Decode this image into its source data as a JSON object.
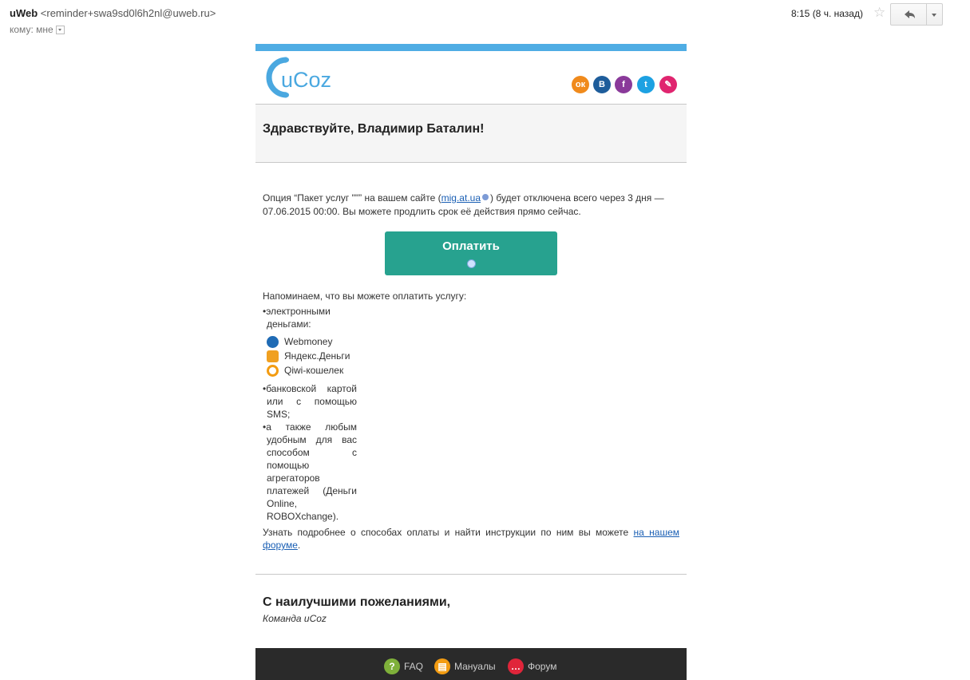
{
  "header": {
    "sender_name": "uWeb",
    "sender_email": "<reminder+swa9sd0l6h2nl@uweb.ru>",
    "to_line": "кому: мне",
    "time": "8:15 (8 ч. назад)",
    "star": "☆",
    "reply_icon": "↩"
  },
  "email": {
    "logo_text": "uCoz",
    "social": [
      {
        "icon": "odnoklassniki-icon",
        "glyph": "ок",
        "color": "#f08a1c"
      },
      {
        "icon": "vk-icon",
        "glyph": "B",
        "color": "#1e5d9b"
      },
      {
        "icon": "facebook-icon",
        "glyph": "f",
        "color": "#8a3a9a"
      },
      {
        "icon": "twitter-icon",
        "glyph": "t",
        "color": "#1da1e2"
      },
      {
        "icon": "edit-icon",
        "glyph": "✎",
        "color": "#e0256f"
      }
    ],
    "greeting": "Здравствуйте, Владимир Баталин!",
    "p1_before": "Опция “Пакет услуг \"\"” на вашем сайте (",
    "p1_link": "mig.at.ua",
    "p1_after": ") будет отключена всего через 3 дня — 07.06.2015 00:00. Вы можете продлить срок её действия прямо сейчас.",
    "pay_button": "Оплатить",
    "reminder": "Напоминаем, что вы можете оплатить услугу:",
    "item_emoney": "•электронными деньгами:",
    "methods": [
      {
        "label": "Webmoney",
        "icon": "webmoney-icon",
        "color": "#1f6bb5"
      },
      {
        "label": "Яндекс.Деньги",
        "icon": "yandex-money-icon",
        "color": "#f0a020"
      },
      {
        "label": "Qiwi-кошелек",
        "icon": "qiwi-icon",
        "color": "#f39c12"
      }
    ],
    "item_card": "•банковской картой или с помощью SMS;",
    "item_other": "•а также любым удобным для вас способом с помощью агрегаторов платежей (Деньги Online, ROBOXchange).",
    "more_before": "Узнать подробнее о способах оплаты и найти инструкции по ним вы можете ",
    "more_link": "на нашем форуме",
    "more_after": ".",
    "sign_title": "С наилучшими пожеланиями,",
    "sign_team": "Команда uCoz",
    "footer": [
      {
        "label": "FAQ",
        "icon": "faq-icon",
        "glyph": "?",
        "color": "#7fb03a"
      },
      {
        "label": "Мануалы",
        "icon": "manuals-icon",
        "glyph": "▤",
        "color": "#f39c12"
      },
      {
        "label": "Форум",
        "icon": "forum-icon",
        "glyph": "…",
        "color": "#e0253a"
      }
    ]
  }
}
